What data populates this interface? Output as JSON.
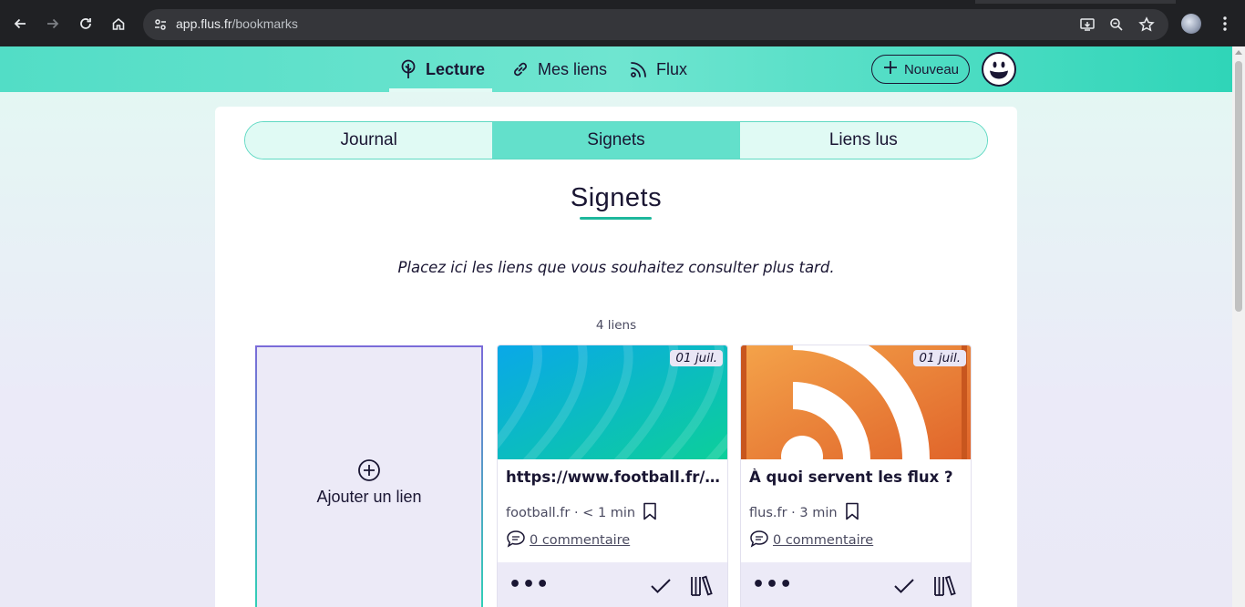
{
  "browser": {
    "url_host": "app.flus.fr",
    "url_path": "/bookmarks"
  },
  "header": {
    "nav": [
      {
        "label": "Lecture",
        "icon": "tree-icon",
        "active": true
      },
      {
        "label": "Mes liens",
        "icon": "link-icon",
        "active": false
      },
      {
        "label": "Flux",
        "icon": "rss-icon",
        "active": false
      }
    ],
    "new_button": "Nouveau"
  },
  "tabs": [
    {
      "label": "Journal",
      "active": false
    },
    {
      "label": "Signets",
      "active": true
    },
    {
      "label": "Liens lus",
      "active": false
    }
  ],
  "page": {
    "title": "Signets",
    "subtitle": "Placez ici les liens que vous souhaitez consulter plus tard.",
    "count": "4 liens"
  },
  "add_card": {
    "label": "Ajouter un lien"
  },
  "links": [
    {
      "date": "01 juil.",
      "title": "https://www.football.fr/france/football-france-coupe-du-monde",
      "meta": "football.fr · < 1 min",
      "comments": "0 commentaire"
    },
    {
      "date": "01 juil.",
      "title": "À quoi servent les flux ?",
      "meta": "flus.fr · 3 min",
      "comments": "0 commentaire"
    }
  ],
  "colors": {
    "accent": "#63e0cb",
    "accent_dark": "#1eb89c",
    "ink": "#1a1633",
    "rss_orange": "#f08a2e"
  }
}
